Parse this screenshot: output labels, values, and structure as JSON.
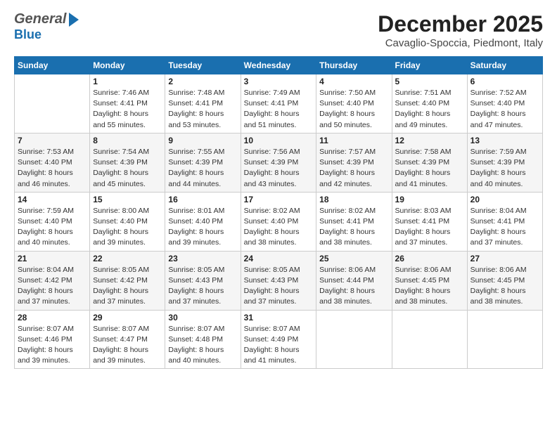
{
  "header": {
    "logo_general": "General",
    "logo_blue": "Blue",
    "month": "December 2025",
    "location": "Cavaglio-Spoccia, Piedmont, Italy"
  },
  "weekdays": [
    "Sunday",
    "Monday",
    "Tuesday",
    "Wednesday",
    "Thursday",
    "Friday",
    "Saturday"
  ],
  "weeks": [
    [
      {
        "day": "",
        "sunrise": "",
        "sunset": "",
        "daylight": ""
      },
      {
        "day": "1",
        "sunrise": "Sunrise: 7:46 AM",
        "sunset": "Sunset: 4:41 PM",
        "daylight": "Daylight: 8 hours and 55 minutes."
      },
      {
        "day": "2",
        "sunrise": "Sunrise: 7:48 AM",
        "sunset": "Sunset: 4:41 PM",
        "daylight": "Daylight: 8 hours and 53 minutes."
      },
      {
        "day": "3",
        "sunrise": "Sunrise: 7:49 AM",
        "sunset": "Sunset: 4:41 PM",
        "daylight": "Daylight: 8 hours and 51 minutes."
      },
      {
        "day": "4",
        "sunrise": "Sunrise: 7:50 AM",
        "sunset": "Sunset: 4:40 PM",
        "daylight": "Daylight: 8 hours and 50 minutes."
      },
      {
        "day": "5",
        "sunrise": "Sunrise: 7:51 AM",
        "sunset": "Sunset: 4:40 PM",
        "daylight": "Daylight: 8 hours and 49 minutes."
      },
      {
        "day": "6",
        "sunrise": "Sunrise: 7:52 AM",
        "sunset": "Sunset: 4:40 PM",
        "daylight": "Daylight: 8 hours and 47 minutes."
      }
    ],
    [
      {
        "day": "7",
        "sunrise": "Sunrise: 7:53 AM",
        "sunset": "Sunset: 4:40 PM",
        "daylight": "Daylight: 8 hours and 46 minutes."
      },
      {
        "day": "8",
        "sunrise": "Sunrise: 7:54 AM",
        "sunset": "Sunset: 4:39 PM",
        "daylight": "Daylight: 8 hours and 45 minutes."
      },
      {
        "day": "9",
        "sunrise": "Sunrise: 7:55 AM",
        "sunset": "Sunset: 4:39 PM",
        "daylight": "Daylight: 8 hours and 44 minutes."
      },
      {
        "day": "10",
        "sunrise": "Sunrise: 7:56 AM",
        "sunset": "Sunset: 4:39 PM",
        "daylight": "Daylight: 8 hours and 43 minutes."
      },
      {
        "day": "11",
        "sunrise": "Sunrise: 7:57 AM",
        "sunset": "Sunset: 4:39 PM",
        "daylight": "Daylight: 8 hours and 42 minutes."
      },
      {
        "day": "12",
        "sunrise": "Sunrise: 7:58 AM",
        "sunset": "Sunset: 4:39 PM",
        "daylight": "Daylight: 8 hours and 41 minutes."
      },
      {
        "day": "13",
        "sunrise": "Sunrise: 7:59 AM",
        "sunset": "Sunset: 4:39 PM",
        "daylight": "Daylight: 8 hours and 40 minutes."
      }
    ],
    [
      {
        "day": "14",
        "sunrise": "Sunrise: 7:59 AM",
        "sunset": "Sunset: 4:40 PM",
        "daylight": "Daylight: 8 hours and 40 minutes."
      },
      {
        "day": "15",
        "sunrise": "Sunrise: 8:00 AM",
        "sunset": "Sunset: 4:40 PM",
        "daylight": "Daylight: 8 hours and 39 minutes."
      },
      {
        "day": "16",
        "sunrise": "Sunrise: 8:01 AM",
        "sunset": "Sunset: 4:40 PM",
        "daylight": "Daylight: 8 hours and 39 minutes."
      },
      {
        "day": "17",
        "sunrise": "Sunrise: 8:02 AM",
        "sunset": "Sunset: 4:40 PM",
        "daylight": "Daylight: 8 hours and 38 minutes."
      },
      {
        "day": "18",
        "sunrise": "Sunrise: 8:02 AM",
        "sunset": "Sunset: 4:41 PM",
        "daylight": "Daylight: 8 hours and 38 minutes."
      },
      {
        "day": "19",
        "sunrise": "Sunrise: 8:03 AM",
        "sunset": "Sunset: 4:41 PM",
        "daylight": "Daylight: 8 hours and 37 minutes."
      },
      {
        "day": "20",
        "sunrise": "Sunrise: 8:04 AM",
        "sunset": "Sunset: 4:41 PM",
        "daylight": "Daylight: 8 hours and 37 minutes."
      }
    ],
    [
      {
        "day": "21",
        "sunrise": "Sunrise: 8:04 AM",
        "sunset": "Sunset: 4:42 PM",
        "daylight": "Daylight: 8 hours and 37 minutes."
      },
      {
        "day": "22",
        "sunrise": "Sunrise: 8:05 AM",
        "sunset": "Sunset: 4:42 PM",
        "daylight": "Daylight: 8 hours and 37 minutes."
      },
      {
        "day": "23",
        "sunrise": "Sunrise: 8:05 AM",
        "sunset": "Sunset: 4:43 PM",
        "daylight": "Daylight: 8 hours and 37 minutes."
      },
      {
        "day": "24",
        "sunrise": "Sunrise: 8:05 AM",
        "sunset": "Sunset: 4:43 PM",
        "daylight": "Daylight: 8 hours and 37 minutes."
      },
      {
        "day": "25",
        "sunrise": "Sunrise: 8:06 AM",
        "sunset": "Sunset: 4:44 PM",
        "daylight": "Daylight: 8 hours and 38 minutes."
      },
      {
        "day": "26",
        "sunrise": "Sunrise: 8:06 AM",
        "sunset": "Sunset: 4:45 PM",
        "daylight": "Daylight: 8 hours and 38 minutes."
      },
      {
        "day": "27",
        "sunrise": "Sunrise: 8:06 AM",
        "sunset": "Sunset: 4:45 PM",
        "daylight": "Daylight: 8 hours and 38 minutes."
      }
    ],
    [
      {
        "day": "28",
        "sunrise": "Sunrise: 8:07 AM",
        "sunset": "Sunset: 4:46 PM",
        "daylight": "Daylight: 8 hours and 39 minutes."
      },
      {
        "day": "29",
        "sunrise": "Sunrise: 8:07 AM",
        "sunset": "Sunset: 4:47 PM",
        "daylight": "Daylight: 8 hours and 39 minutes."
      },
      {
        "day": "30",
        "sunrise": "Sunrise: 8:07 AM",
        "sunset": "Sunset: 4:48 PM",
        "daylight": "Daylight: 8 hours and 40 minutes."
      },
      {
        "day": "31",
        "sunrise": "Sunrise: 8:07 AM",
        "sunset": "Sunset: 4:49 PM",
        "daylight": "Daylight: 8 hours and 41 minutes."
      },
      {
        "day": "",
        "sunrise": "",
        "sunset": "",
        "daylight": ""
      },
      {
        "day": "",
        "sunrise": "",
        "sunset": "",
        "daylight": ""
      },
      {
        "day": "",
        "sunrise": "",
        "sunset": "",
        "daylight": ""
      }
    ]
  ]
}
